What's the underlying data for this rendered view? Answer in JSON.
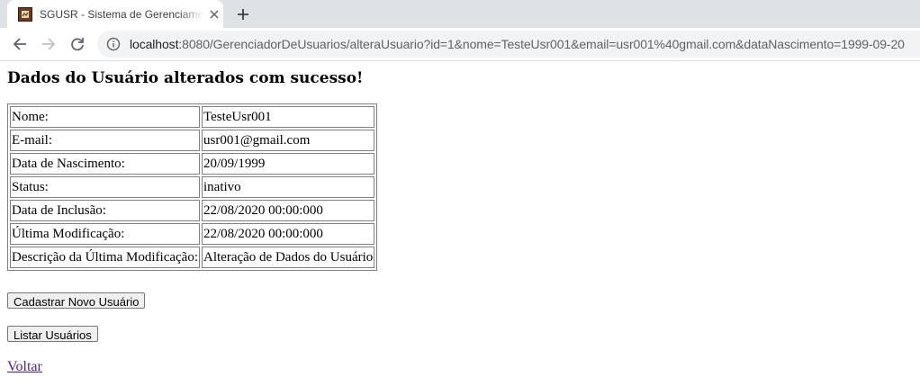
{
  "browser": {
    "tab_title": "SGUSR - Sistema de Gerenciamento",
    "url_host": "localhost",
    "url_rest": ":8080/GerenciadorDeUsuarios/alteraUsuario?id=1&nome=TesteUsr001&email=usr001%40gmail.com&dataNascimento=1999-09-20"
  },
  "page": {
    "heading": "Dados do Usuário alterados com sucesso!",
    "rows": [
      {
        "label": "Nome:",
        "value": "TesteUsr001"
      },
      {
        "label": "E-mail:",
        "value": "usr001@gmail.com"
      },
      {
        "label": "Data de Nascimento:",
        "value": "20/09/1999"
      },
      {
        "label": "Status:",
        "value": "inativo"
      },
      {
        "label": "Data de Inclusão:",
        "value": "22/08/2020 00:00:000"
      },
      {
        "label": "Última Modificação:",
        "value": "22/08/2020 00:00:000"
      },
      {
        "label": "Descrição da Última Modificação:",
        "value": "Alteração de Dados do Usuário"
      }
    ],
    "button_new_user": "Cadastrar Novo Usuário",
    "button_list_users": "Listar Usuários",
    "link_back": "Voltar"
  }
}
